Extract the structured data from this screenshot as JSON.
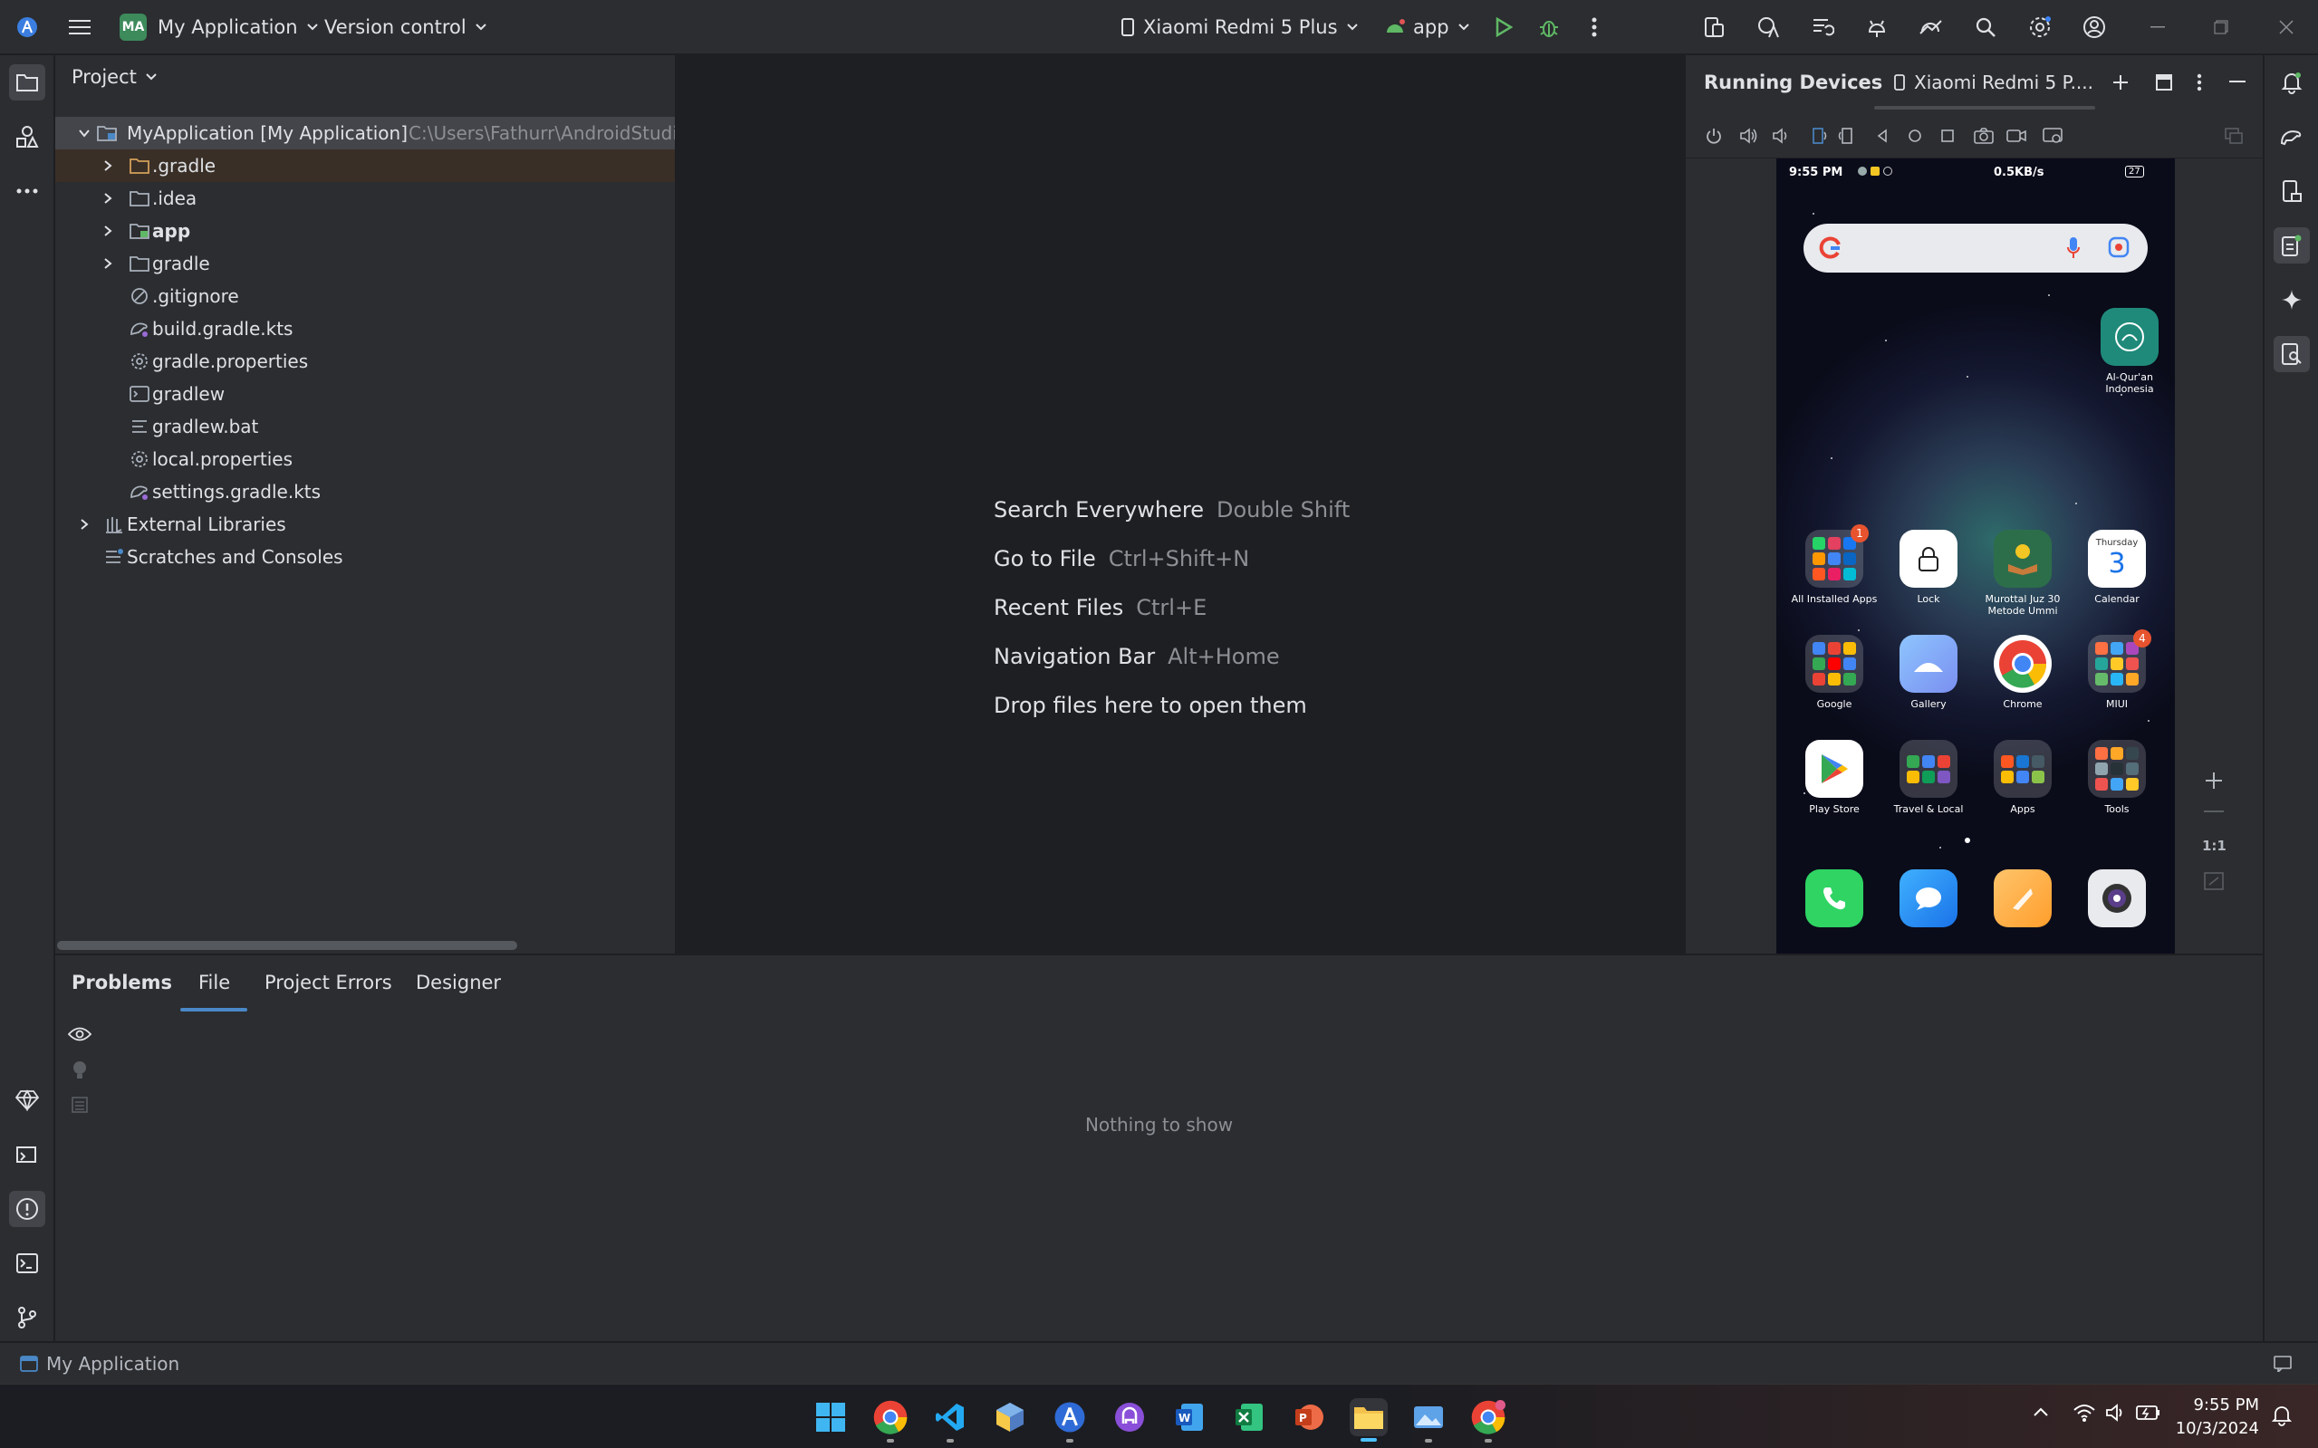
{
  "titlebar": {
    "project_badge": "MA",
    "project_name": "My Application",
    "version_control": "Version control",
    "device": "Xiaomi Redmi 5 Plus",
    "run_config": "app"
  },
  "project_panel": {
    "title": "Project",
    "root": {
      "label": "MyApplication [My Application]",
      "path": "C:\\Users\\Fathurr\\AndroidStudioP"
    },
    "items": [
      {
        "label": ".gradle",
        "icon": "folder-icon"
      },
      {
        "label": ".idea",
        "icon": "folder-icon"
      },
      {
        "label": "app",
        "icon": "module-folder-icon"
      },
      {
        "label": "gradle",
        "icon": "folder-icon"
      },
      {
        "label": ".gitignore",
        "icon": "ignore-file-icon"
      },
      {
        "label": "build.gradle.kts",
        "icon": "gradle-file-icon"
      },
      {
        "label": "gradle.properties",
        "icon": "settings-file-icon"
      },
      {
        "label": "gradlew",
        "icon": "terminal-file-icon"
      },
      {
        "label": "gradlew.bat",
        "icon": "text-file-icon"
      },
      {
        "label": "local.properties",
        "icon": "settings-file-icon"
      },
      {
        "label": "settings.gradle.kts",
        "icon": "gradle-file-icon"
      },
      {
        "label": "External Libraries",
        "icon": "library-icon"
      },
      {
        "label": "Scratches and Consoles",
        "icon": "scratches-icon"
      }
    ]
  },
  "editor": {
    "hints": [
      {
        "action": "Search Everywhere",
        "shortcut": "Double Shift"
      },
      {
        "action": "Go to File",
        "shortcut": "Ctrl+Shift+N"
      },
      {
        "action": "Recent Files",
        "shortcut": "Ctrl+E"
      },
      {
        "action": "Navigation Bar",
        "shortcut": "Alt+Home"
      },
      {
        "action": "Drop files here to open them",
        "shortcut": ""
      }
    ]
  },
  "running_devices": {
    "title": "Running Devices",
    "tab_label": "Xiaomi Redmi 5 P....",
    "zoom_label": "1:1",
    "phone": {
      "time": "9:55 PM",
      "net_speed": "0.5KB/s",
      "battery": "27",
      "apps": [
        {
          "label": "Al-Qur'an Indonesia",
          "color": "#1f8a7a"
        },
        {
          "label": "All Installed Apps",
          "badge": "1"
        },
        {
          "label": "Lock",
          "color": "#ffffff"
        },
        {
          "label": "Murottal Juz 30 Metode Ummi",
          "color": "#2d6e4a"
        },
        {
          "label": "Calendar",
          "weekday": "Thursday",
          "day": "3"
        },
        {
          "label": "Google"
        },
        {
          "label": "Gallery",
          "color": "#7ab0f0"
        },
        {
          "label": "Chrome"
        },
        {
          "label": "MIUI",
          "badge": "4"
        },
        {
          "label": "Play Store",
          "color": "#ffffff"
        },
        {
          "label": "Travel & Local"
        },
        {
          "label": "Apps"
        },
        {
          "label": "Tools"
        }
      ],
      "dock": [
        "phone-icon",
        "messages-icon",
        "notes-icon",
        "camera-icon"
      ]
    }
  },
  "problems": {
    "tabs": [
      "Problems",
      "File",
      "Project Errors",
      "Designer"
    ],
    "active_tab": "File",
    "empty_text": "Nothing to show"
  },
  "statusline": {
    "project": "My Application"
  },
  "taskbar": {
    "time": "9:55 PM",
    "date": "10/3/2024"
  },
  "colors": {
    "accent": "#4a88c7",
    "background": "#1e1f22",
    "panel": "#2b2d30",
    "run_green": "#5fb865"
  }
}
